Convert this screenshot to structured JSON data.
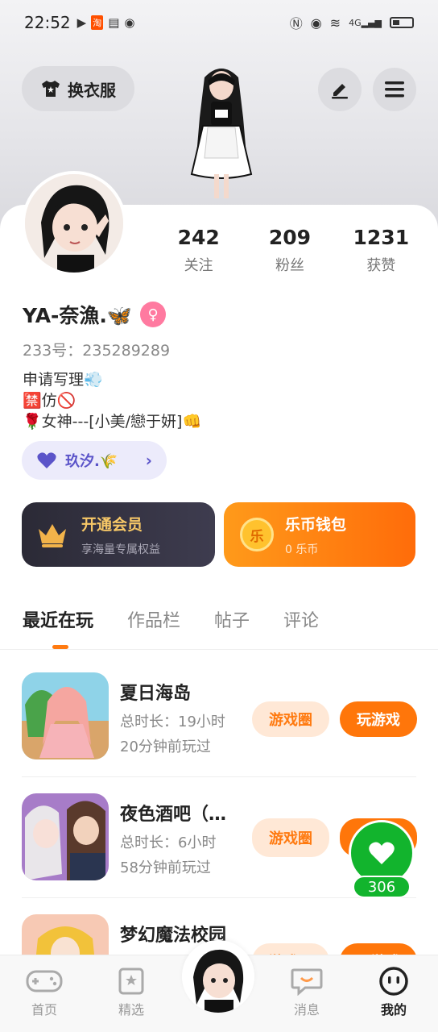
{
  "status": {
    "time": "22:52",
    "net": "4G"
  },
  "header": {
    "dress_label": "换衣服"
  },
  "profile": {
    "stats": [
      {
        "num": "242",
        "label": "关注"
      },
      {
        "num": "209",
        "label": "粉丝"
      },
      {
        "num": "1231",
        "label": "获赞"
      }
    ],
    "name": "YA-奈漁.🦋",
    "gender_icon": "♀",
    "id_text": "233号：235289289",
    "bio": [
      "申请写理💨",
      "🈲仿🚫",
      "🌹女神---[小美/戀于妍]👊"
    ],
    "guild": "玖汐.🌾"
  },
  "vip": {
    "title": "开通会员",
    "subtitle": "享海量专属权益"
  },
  "wallet": {
    "coin_char": "乐",
    "title": "乐币钱包",
    "subtitle": "0 乐币"
  },
  "tabs": [
    "最近在玩",
    "作品栏",
    "帖子",
    "评论"
  ],
  "games": [
    {
      "name": "夏日海岛",
      "duration": "总时长：19小时",
      "last": "20分钟前玩过",
      "circle": "游戏圈",
      "play": "玩游戏"
    },
    {
      "name": "夜色酒吧（…",
      "duration": "总时长：6小时",
      "last": "58分钟前玩过",
      "circle": "游戏圈",
      "play": "玩游戏"
    },
    {
      "name": "梦幻魔法校园",
      "duration": "",
      "last": "",
      "circle": "游戏圈",
      "play": "玩游戏"
    }
  ],
  "like": {
    "count": "306"
  },
  "nav": [
    "首页",
    "精选",
    "消息",
    "我的"
  ],
  "colors": {
    "accent": "#ff760a",
    "like": "#12b42d",
    "gold": "#f7c867"
  }
}
